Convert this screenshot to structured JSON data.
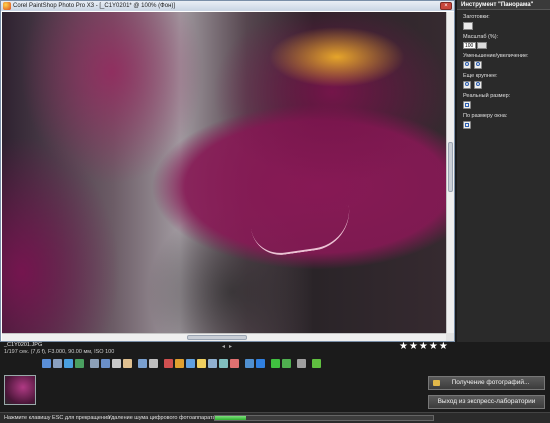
{
  "window": {
    "title": "Corel PaintShop Photo Pro X3 - [_C1Y0201* @ 100% (Фон)]"
  },
  "panel": {
    "header": "Инструмент \"Панорама\"",
    "presets_label": "Заготовки:",
    "scale_label": "Масштаб (%):",
    "scale_value": "100",
    "zoom_out_in_label": "Уменьшение/увеличение:",
    "zoom_more_label": "Еще крупнее:",
    "actual_size_label": "Реальный размер:",
    "fit_window_label": "По размеру окна:"
  },
  "file_info": {
    "name": "_C1Y0201.JPG",
    "exif": "1/197 сек. (7,6 f), F3.000, 90.00 мм, ISO 100",
    "rating_stars": "★★★★★"
  },
  "filmstrip": {
    "get_photos_label": "Получение фотографий...",
    "exit_label": "Выход из экспресс-лаборатории"
  },
  "status": {
    "left_text": "Нажмите клавишу ESC для прекращения",
    "mid_text": "Удаление шума цифрового фотоаппарата",
    "progress": 0.14
  },
  "toolbar": {
    "icons": [
      {
        "name": "save-icon",
        "color": "#5a8fd8"
      },
      {
        "name": "save-as-icon",
        "color": "#8aa0c0"
      },
      {
        "name": "undo-icon",
        "color": "#4aa0e0"
      },
      {
        "name": "redo-icon",
        "color": "#4aa060"
      },
      {
        "name": "gap",
        "color": ""
      },
      {
        "name": "view-icon",
        "color": "#8ca0b8"
      },
      {
        "name": "fit-icon",
        "color": "#6a8fc8"
      },
      {
        "name": "zoom-icon",
        "color": "#c8c8c8"
      },
      {
        "name": "pan-icon",
        "color": "#e0c090"
      },
      {
        "name": "gap",
        "color": ""
      },
      {
        "name": "straighten-icon",
        "color": "#7aa0d0"
      },
      {
        "name": "crop-icon",
        "color": "#c0c0c0"
      },
      {
        "name": "gap",
        "color": ""
      },
      {
        "name": "red-eye-icon",
        "color": "#d05050"
      },
      {
        "name": "color-fix-icon",
        "color": "#e0a030"
      },
      {
        "name": "makeover-icon",
        "color": "#60a0e0"
      },
      {
        "name": "brightness-icon",
        "color": "#f0d060"
      },
      {
        "name": "sharpen-icon",
        "color": "#90b0d0"
      },
      {
        "name": "clone-icon",
        "color": "#80c0c0"
      },
      {
        "name": "skin-icon",
        "color": "#e07070"
      },
      {
        "name": "gap",
        "color": ""
      },
      {
        "name": "noise-icon",
        "color": "#5090d0"
      },
      {
        "name": "fill-flash-icon",
        "color": "#3080e0"
      },
      {
        "name": "gap",
        "color": ""
      },
      {
        "name": "rotate-icon",
        "color": "#40c040"
      },
      {
        "name": "flag-icon",
        "color": "#50b050"
      },
      {
        "name": "gap",
        "color": ""
      },
      {
        "name": "delete-icon",
        "color": "#a0a0a0"
      },
      {
        "name": "gap",
        "color": ""
      },
      {
        "name": "edit-icon",
        "color": "#60c040"
      }
    ]
  }
}
